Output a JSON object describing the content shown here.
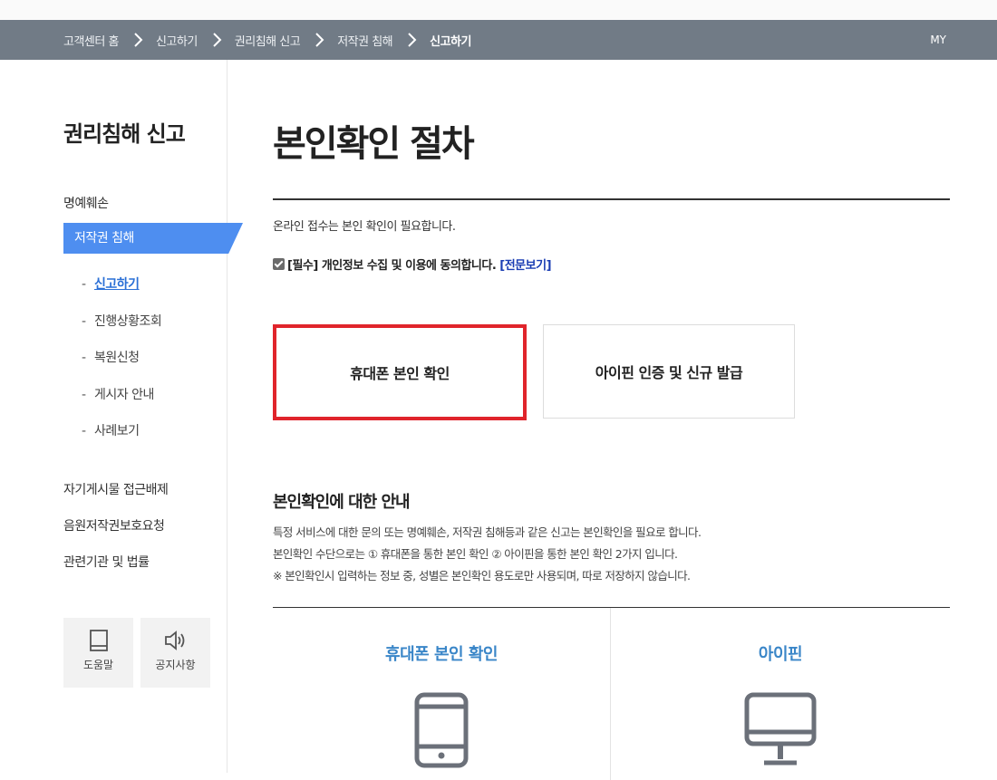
{
  "breadcrumb": {
    "items": [
      "고객센터 홈",
      "신고하기",
      "권리침해 신고",
      "저작권 침해",
      "신고하기"
    ],
    "my": "MY"
  },
  "sidebar": {
    "title": "권리침해 신고",
    "items": {
      "defamation": "명예훼손",
      "copyright": "저작권 침해",
      "self_post": "자기게시물 접근배제",
      "music": "음원저작권보호요청",
      "law": "관련기관 및 법률"
    },
    "sub_items": [
      "신고하기",
      "진행상황조회",
      "복원신청",
      "게시자 안내",
      "사례보기"
    ],
    "quick": {
      "help": "도움말",
      "notice": "공지사항"
    }
  },
  "main": {
    "title": "본인확인 절차",
    "intro": "온라인 접수는 본인 확인이 필요합니다.",
    "consent": {
      "checked": true,
      "text": "[필수] 개인정보 수집 및 이용에 동의합니다.",
      "link": "[전문보기]"
    },
    "auth": {
      "phone": "휴대폰 본인 확인",
      "ipin": "아이핀 인증 및 신규 발급"
    },
    "guide": {
      "title": "본인확인에 대한 안내",
      "lines": [
        "특정 서비스에 대한 문의 또는 명예훼손, 저작권 침해등과 같은 신고는 본인확인을 필요로 합니다.",
        "본인확인 수단으로는 ① 휴대폰을 통한 본인 확인 ② 아이핀을 통한 본인 확인 2가지 입니다.",
        "※ 본인확인시 입력하는 정보 중, 성별은 본인확인 용도로만 사용되며, 따로 저장하지 않습니다."
      ]
    },
    "methods": {
      "phone": "휴대폰 본인 확인",
      "ipin": "아이핀"
    }
  },
  "colors": {
    "nav": "#717b86",
    "accent": "#4e8ef0",
    "highlight": "#e0242b",
    "method_title": "#3a86c8"
  }
}
